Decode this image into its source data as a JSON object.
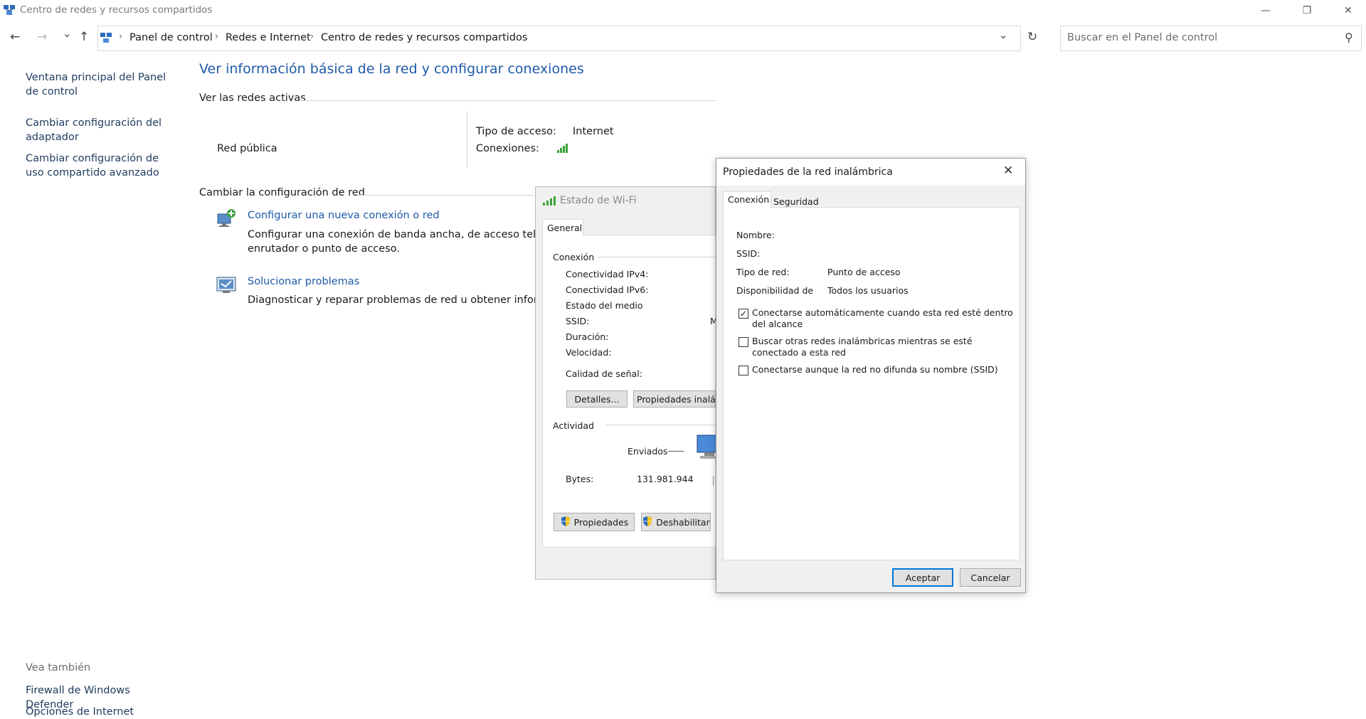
{
  "window": {
    "title": "Centro de redes y recursos compartidos",
    "minimize_glyph": "—",
    "restore_glyph": "❐",
    "close_glyph": "✕"
  },
  "navigation": {
    "back_glyph": "←",
    "forward_glyph": "→",
    "recent_glyph": "⌄",
    "up_glyph": "↑",
    "breadcrumbs": [
      "Panel de control",
      "Redes e Internet",
      "Centro de redes y recursos compartidos"
    ],
    "separator_glyph": "›",
    "dropdown_glyph": "⌄",
    "refresh_glyph": "↻",
    "search_placeholder": "Buscar en el Panel de control",
    "search_glyph": "⚲"
  },
  "sidebar": {
    "links": [
      "Ventana principal del Panel de control",
      "Cambiar configuración del adaptador",
      "Cambiar configuración de uso compartido avanzado"
    ],
    "see_also_title": "Vea también",
    "see_also": [
      "Firewall de Windows Defender",
      "Opciones de Internet"
    ]
  },
  "main": {
    "heading": "Ver información básica de la red y configurar conexiones",
    "active_networks_label": "Ver las redes activas",
    "network_name": "Red pública",
    "access_type_label": "Tipo de acceso:",
    "access_type_value": "Internet",
    "connections_label": "Conexiones:",
    "change_settings_label": "Cambiar la configuración de red",
    "tasks": [
      {
        "title": "Configurar una nueva conexión o red",
        "description": "Configurar una conexión de banda ancha, de acceso telefóni",
        "description2": "enrutador o punto de acceso."
      },
      {
        "title": "Solucionar problemas",
        "description": "Diagnosticar y reparar problemas de red u obtener informaci"
      }
    ]
  },
  "wifi_status": {
    "title": "Estado de Wi-Fi",
    "tab": "General",
    "connection_group": "Conexión",
    "rows": [
      "Conectividad IPv4:",
      "Conectividad IPv6:",
      "Estado del medio",
      "SSID:",
      "Duración:",
      "Velocidad:"
    ],
    "ssid_partial": "M",
    "signal_label": "Calidad de señal:",
    "details_button": "Detalles...",
    "wireless_props_button": "Propiedades inalám",
    "activity_group": "Actividad",
    "sent_label": "Enviados",
    "bytes_label": "Bytes:",
    "bytes_sent": "131.981.944",
    "properties_button": "Propiedades",
    "disable_button": "Deshabilitar"
  },
  "wireless_props": {
    "title": "Propiedades de la red inalámbrica",
    "close_glyph": "✕",
    "tabs": [
      "Conexión",
      "Seguridad"
    ],
    "fields": [
      {
        "label": "Nombre:",
        "value": ""
      },
      {
        "label": "SSID:",
        "value": ""
      },
      {
        "label": "Tipo de red:",
        "value": "Punto de acceso"
      },
      {
        "label": "Disponibilidad de",
        "value": "Todos los usuarios"
      }
    ],
    "checkboxes": [
      {
        "label": "Conectarse automáticamente cuando esta red esté dentro",
        "label2": "del alcance",
        "checked": true,
        "mark": "✓"
      },
      {
        "label": "Buscar otras redes inalámbricas mientras se esté",
        "label2": "conectado a esta red",
        "checked": false,
        "mark": ""
      },
      {
        "label": "Conectarse aunque la red no difunda su nombre (SSID)",
        "label2": "",
        "checked": false,
        "mark": ""
      }
    ],
    "ok_button": "Aceptar",
    "cancel_button": "Cancelar"
  },
  "colors": {
    "link_blue": "#1e5aa8",
    "accent": "#0078d7",
    "dialog_bg": "#f0f0f0"
  }
}
